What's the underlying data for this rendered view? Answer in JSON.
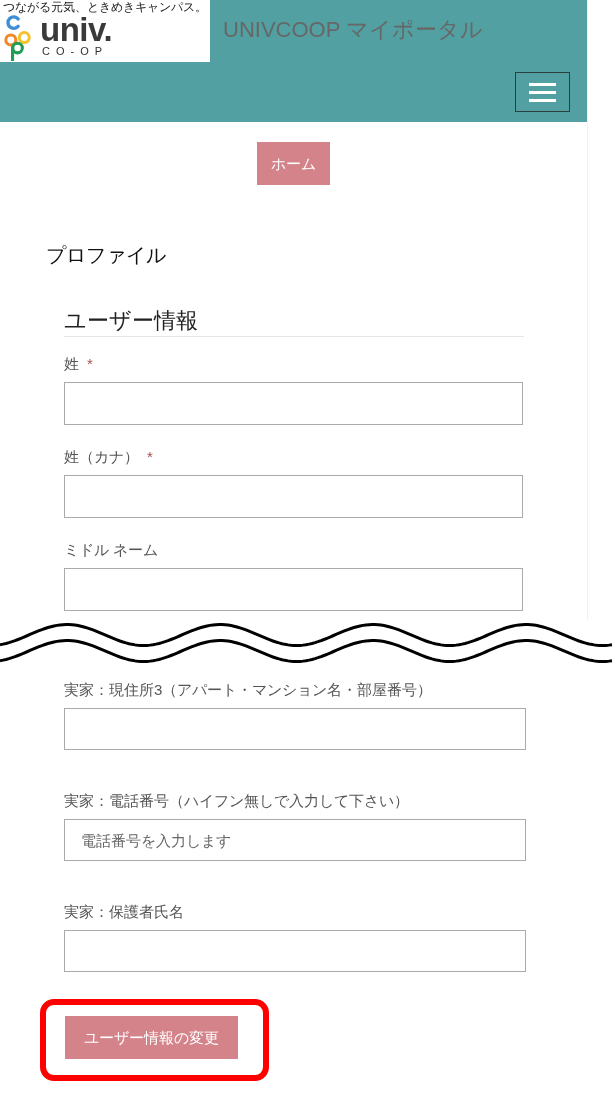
{
  "header": {
    "logo": {
      "tagline": "つながる元気、ときめきキャンパス。",
      "wordmark": "univ.",
      "subtitle": "CO-OP"
    },
    "title": "UNIVCOOP マイポータル"
  },
  "home_button": {
    "label": "ホーム"
  },
  "page_title": "プロファイル",
  "section": {
    "title": "ユーザー情報",
    "fields": [
      {
        "label": "姓",
        "required_mark": "*"
      },
      {
        "label": "姓（カナ）",
        "required_mark": "*"
      },
      {
        "label": "ミドル ネーム"
      }
    ]
  },
  "section_after_break": {
    "fields": [
      {
        "label": "実家：現住所3（アパート・マンション名・部屋番号）"
      },
      {
        "label": "実家：電話番号（ハイフン無しで入力して下さい）",
        "placeholder": "電話番号を入力します"
      },
      {
        "label": "実家：保護者氏名"
      }
    ]
  },
  "submit_button": {
    "label": "ユーザー情報の変更",
    "highlighted": true
  }
}
